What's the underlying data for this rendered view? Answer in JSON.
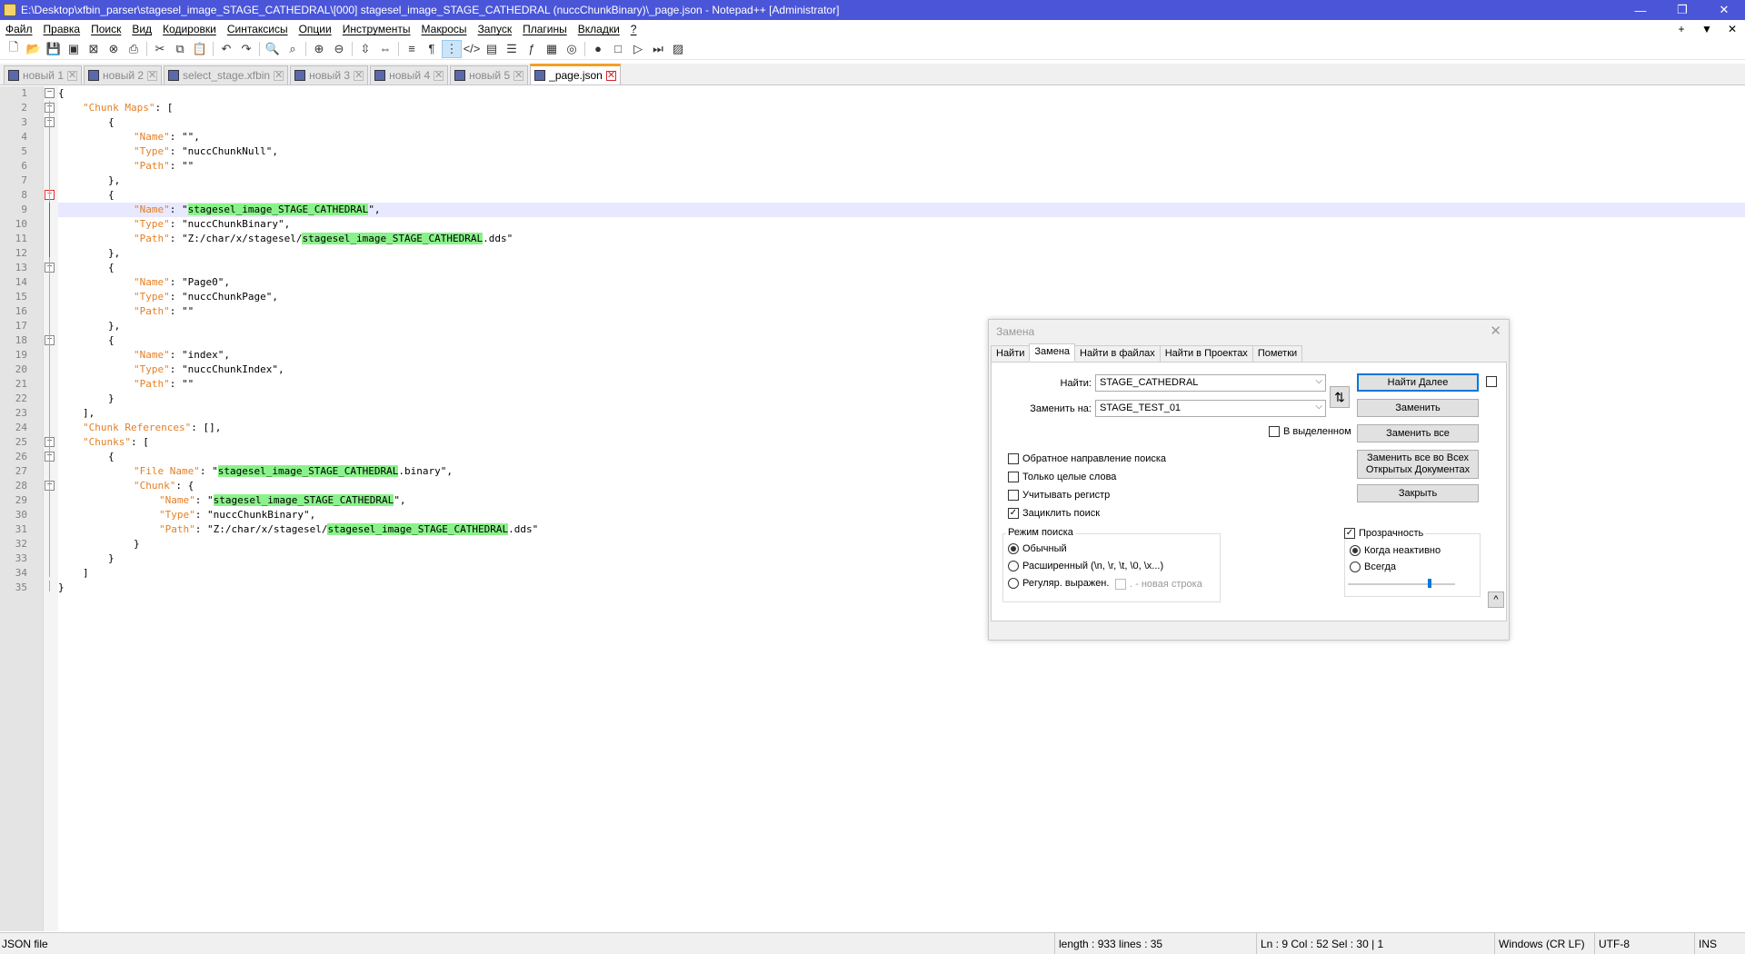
{
  "window": {
    "title": "E:\\Desktop\\xfbin_parser\\stagesel_image_STAGE_CATHEDRAL\\[000] stagesel_image_STAGE_CATHEDRAL (nuccChunkBinary)\\_page.json - Notepad++ [Administrator]",
    "minimize": "—",
    "maximize": "❐",
    "close": "✕"
  },
  "menu": {
    "items": [
      "Файл",
      "Правка",
      "Поиск",
      "Вид",
      "Кодировки",
      "Синтаксисы",
      "Опции",
      "Инструменты",
      "Макросы",
      "Запуск",
      "Плагины",
      "Вкладки",
      "?"
    ],
    "right": [
      "+",
      "▼",
      "✕"
    ]
  },
  "tabs": [
    {
      "label": "новый 1"
    },
    {
      "label": "новый 2"
    },
    {
      "label": "select_stage.xfbin"
    },
    {
      "label": "новый 3"
    },
    {
      "label": "новый 4"
    },
    {
      "label": "новый 5"
    },
    {
      "label": "_page.json"
    }
  ],
  "editor": {
    "line_numbers": [
      "1",
      "2",
      "3",
      "4",
      "5",
      "6",
      "7",
      "8",
      "9",
      "10",
      "11",
      "12",
      "13",
      "14",
      "15",
      "16",
      "17",
      "18",
      "19",
      "20",
      "21",
      "22",
      "23",
      "24",
      "25",
      "26",
      "27",
      "28",
      "29",
      "30",
      "31",
      "32",
      "33",
      "34",
      "35"
    ],
    "current_line": 9
  },
  "code": {
    "l1": "{",
    "l2_key": "\"Chunk Maps\"",
    "l2_rest": ": [",
    "l3": "{",
    "l4_key": "\"Name\"",
    "l4_rest": ": \"\",",
    "l5_key": "\"Type\"",
    "l5_rest": ": \"nuccChunkNull\",",
    "l6_key": "\"Path\"",
    "l6_rest": ": \"\"",
    "l7": "},",
    "l8": "{",
    "l9_key": "\"Name\"",
    "l9_a": ": \"",
    "l9_hl": "stagesel_image_STAGE_CATHEDRAL",
    "l9_b": "\",",
    "l10_key": "\"Type\"",
    "l10_rest": ": \"nuccChunkBinary\",",
    "l11_key": "\"Path\"",
    "l11_a": ": \"Z:/char/x/stagesel/",
    "l11_hl": "stagesel_image_STAGE_CATHEDRAL",
    "l11_b": ".dds\"",
    "l12": "},",
    "l13": "{",
    "l14_key": "\"Name\"",
    "l14_rest": ": \"Page0\",",
    "l15_key": "\"Type\"",
    "l15_rest": ": \"nuccChunkPage\",",
    "l16_key": "\"Path\"",
    "l16_rest": ": \"\"",
    "l17": "},",
    "l18": "{",
    "l19_key": "\"Name\"",
    "l19_rest": ": \"index\",",
    "l20_key": "\"Type\"",
    "l20_rest": ": \"nuccChunkIndex\",",
    "l21_key": "\"Path\"",
    "l21_rest": ": \"\"",
    "l22": "}",
    "l23": "],",
    "l24_key": "\"Chunk References\"",
    "l24_rest": ": [],",
    "l25_key": "\"Chunks\"",
    "l25_rest": ": [",
    "l26": "{",
    "l27_key": "\"File Name\"",
    "l27_a": ": \"",
    "l27_hl": "stagesel_image_STAGE_CATHEDRAL",
    "l27_b": ".binary\",",
    "l28_key": "\"Chunk\"",
    "l28_rest": ": {",
    "l29_key": "\"Name\"",
    "l29_a": ": \"",
    "l29_hl": "stagesel_image_STAGE_CATHEDRAL",
    "l29_b": "\",",
    "l30_key": "\"Type\"",
    "l30_rest": ": \"nuccChunkBinary\",",
    "l31_key": "\"Path\"",
    "l31_a": ": \"Z:/char/x/stagesel/",
    "l31_hl": "stagesel_image_STAGE_CATHEDRAL",
    "l31_b": ".dds\"",
    "l32": "}",
    "l33": "}",
    "l34": "]",
    "l35": "}"
  },
  "dialog": {
    "title": "Замена",
    "close": "✕",
    "tabs": [
      "Найти",
      "Замена",
      "Найти в файлах",
      "Найти в Проектах",
      "Пометки"
    ],
    "find_label": "Найти:",
    "find_value": "STAGE_CATHEDRAL",
    "replace_label": "Заменить на:",
    "replace_value": "STAGE_TEST_01",
    "swap": "⇅",
    "in_selection": "В выделенном",
    "btn_find_next": "Найти Далее",
    "btn_replace": "Заменить",
    "btn_replace_all": "Заменить все",
    "btn_replace_all_docs_1": "Заменить все во Всех",
    "btn_replace_all_docs_2": "Открытых Документах",
    "btn_close": "Закрыть",
    "opt_backward": "Обратное направление поиска",
    "opt_whole_word": "Только целые слова",
    "opt_match_case": "Учитывать регистр",
    "opt_wrap": "Зациклить поиск",
    "mode_group": "Режим поиска",
    "mode_normal": "Обычный",
    "mode_extended": "Расширенный (\\n, \\r, \\t, \\0, \\x...)",
    "mode_regex": "Регуляр. выражен.",
    "mode_newline": ". - новая строка",
    "transparency": "Прозрачность",
    "trans_inactive": "Когда неактивно",
    "trans_always": "Всегда",
    "collapse": "^",
    "wrap_checked": true,
    "transparency_checked": true
  },
  "status": {
    "filetype": "JSON file",
    "length": "length : 933    lines : 35",
    "position": "Ln : 9    Col : 52    Sel : 30 | 1",
    "eol": "Windows (CR LF)",
    "encoding": "UTF-8",
    "mode": "INS"
  }
}
